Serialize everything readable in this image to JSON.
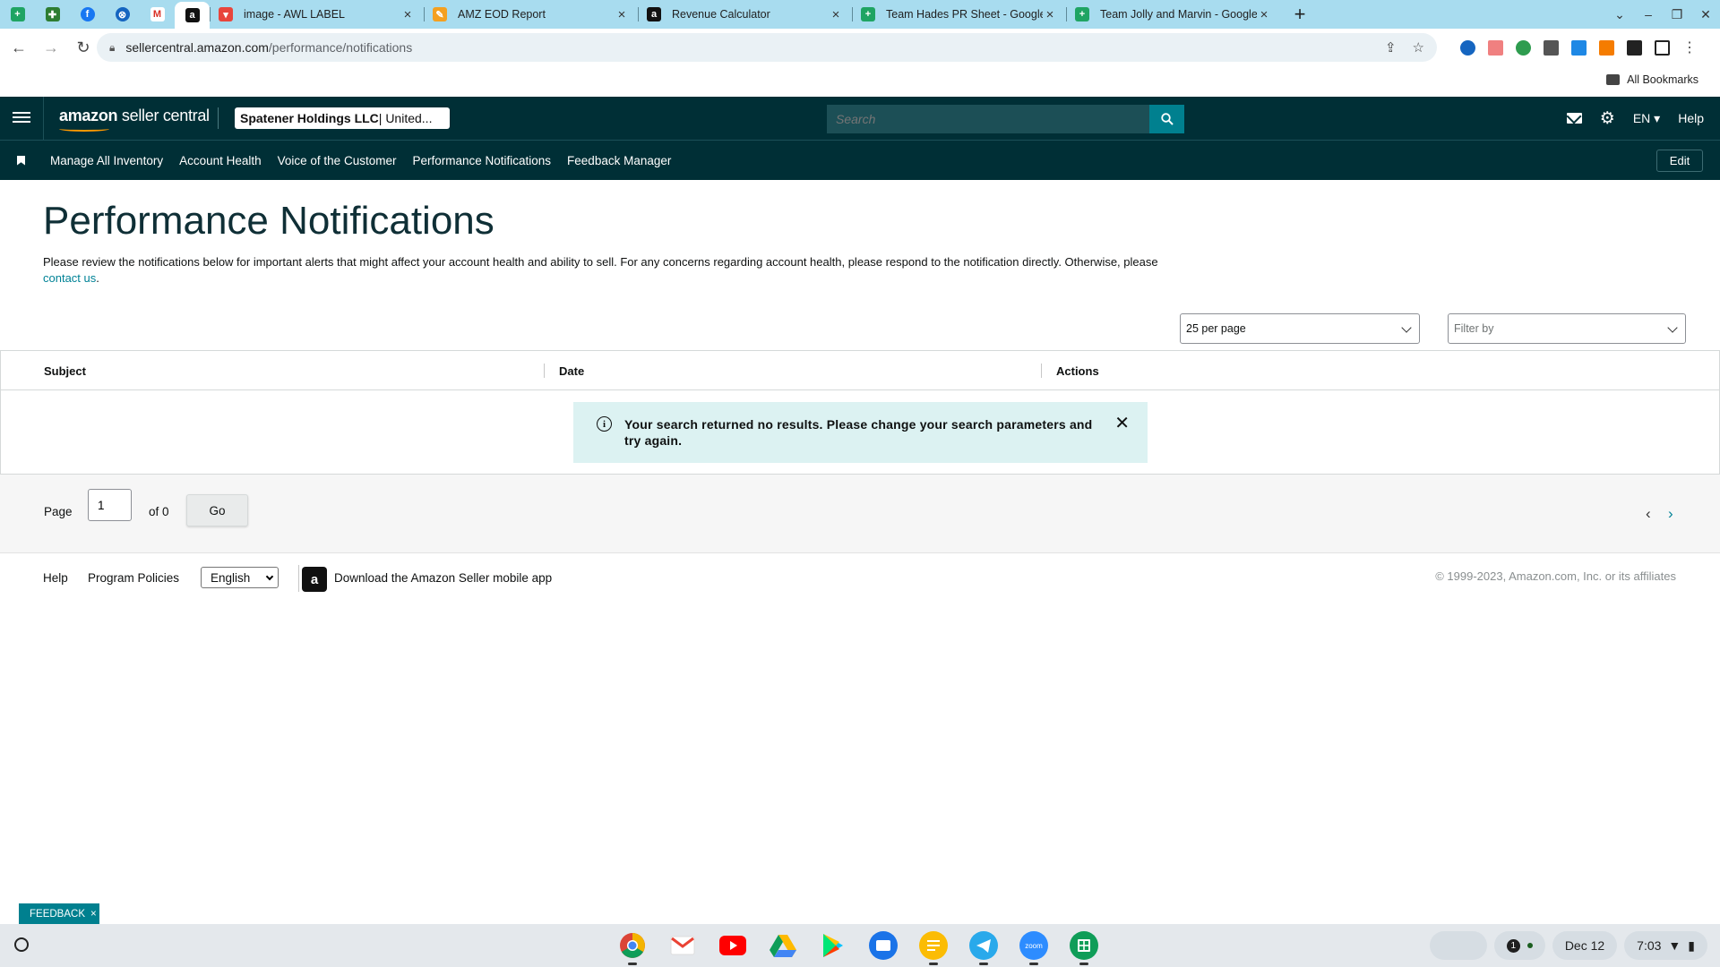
{
  "browser": {
    "tabs": [
      {
        "title": "image - AWL LABEL",
        "favicon": "awl-label-icon",
        "color": "#e8453c"
      },
      {
        "title": "AMZ EOD Report",
        "favicon": "eod-report-icon",
        "color": "#f4a020"
      },
      {
        "title": "Revenue Calculator",
        "favicon": "amazon-icon",
        "color": "#111111"
      },
      {
        "title": "Team Hades PR Sheet - Google",
        "favicon": "sheets-icon",
        "color": "#1fa463"
      },
      {
        "title": "Team Jolly and Marvin - Google",
        "favicon": "sheets-icon",
        "color": "#1fa463"
      }
    ],
    "url_host": "sellercentral.amazon.com",
    "url_path": "/performance/notifications",
    "all_bookmarks": "All Bookmarks"
  },
  "header": {
    "logo_bold": "amazon",
    "logo_rest": " seller central",
    "store_name": "Spatener Holdings LLC",
    "store_region": " | United...",
    "search_placeholder": "Search",
    "lang": "EN",
    "help": "Help"
  },
  "nav": {
    "items": [
      "Manage All Inventory",
      "Account Health",
      "Voice of the Customer",
      "Performance Notifications",
      "Feedback Manager"
    ],
    "edit": "Edit"
  },
  "main": {
    "title": "Performance Notifications",
    "intro_text": "Please review the notifications below for important alerts that might affect your account health and ability to sell. For any concerns regarding account health, please respond to the notification directly. Otherwise, please ",
    "intro_link": "contact us",
    "intro_end": ".",
    "per_page": "25 per page",
    "filter_placeholder": "Filter by",
    "columns": [
      "Subject",
      "Date",
      "Actions"
    ],
    "no_results": "Your search returned no results. Please change your search parameters and try again."
  },
  "pager": {
    "page_label": "Page",
    "current_page": "1",
    "of_label": "of 0",
    "go": "Go"
  },
  "footer": {
    "help": "Help",
    "program_policies": "Program Policies",
    "language": "English",
    "app_download": "Download the Amazon Seller mobile app",
    "copyright": "© 1999-2023, Amazon.com, Inc. or its affiliates"
  },
  "feedback": {
    "label": "FEEDBACK",
    "close": "×"
  },
  "shelf": {
    "apps": [
      "chrome-icon",
      "gmail-icon",
      "youtube-icon",
      "drive-icon",
      "play-store-icon",
      "files-icon",
      "keep-icon",
      "telegram-icon",
      "zoom-icon",
      "sheets-icon"
    ],
    "notification_count": "1",
    "date": "Dec 12",
    "time": "7:03"
  }
}
